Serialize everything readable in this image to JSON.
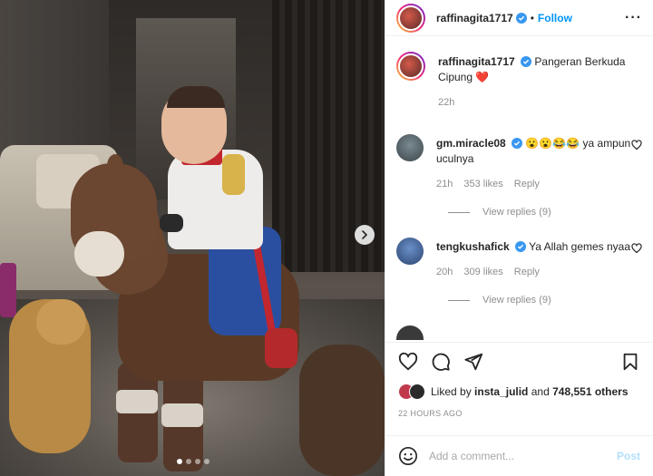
{
  "post": {
    "author": "raffinagita1717",
    "follow_label": "Follow",
    "more_label": "···",
    "separator": "•",
    "caption": "Pangeran Berkuda Cipung",
    "caption_emoji": "❤️",
    "caption_age": "22h"
  },
  "comments": [
    {
      "username": "gm.miracle08",
      "text": "😮😮😂😂 ya ampun uculnya",
      "age": "21h",
      "likes": "353 likes",
      "reply_label": "Reply",
      "view_replies": "View replies (9)"
    },
    {
      "username": "tengkushafick",
      "text": "Ya Allah gemes nyaa",
      "age": "20h",
      "likes": "309 likes",
      "reply_label": "Reply",
      "view_replies": "View replies (9)"
    }
  ],
  "likes_summary": {
    "prefix": "Liked by",
    "user": "insta_julid",
    "connector": "and",
    "others": "748,551 others"
  },
  "timestamp": "22 HOURS AGO",
  "composer": {
    "placeholder": "Add a comment...",
    "post_label": "Post"
  },
  "carousel": {
    "slides": 4,
    "active": 1
  },
  "colors": {
    "link": "#0095f6",
    "verified": "#3897f0",
    "like_red": "#c0394b"
  }
}
